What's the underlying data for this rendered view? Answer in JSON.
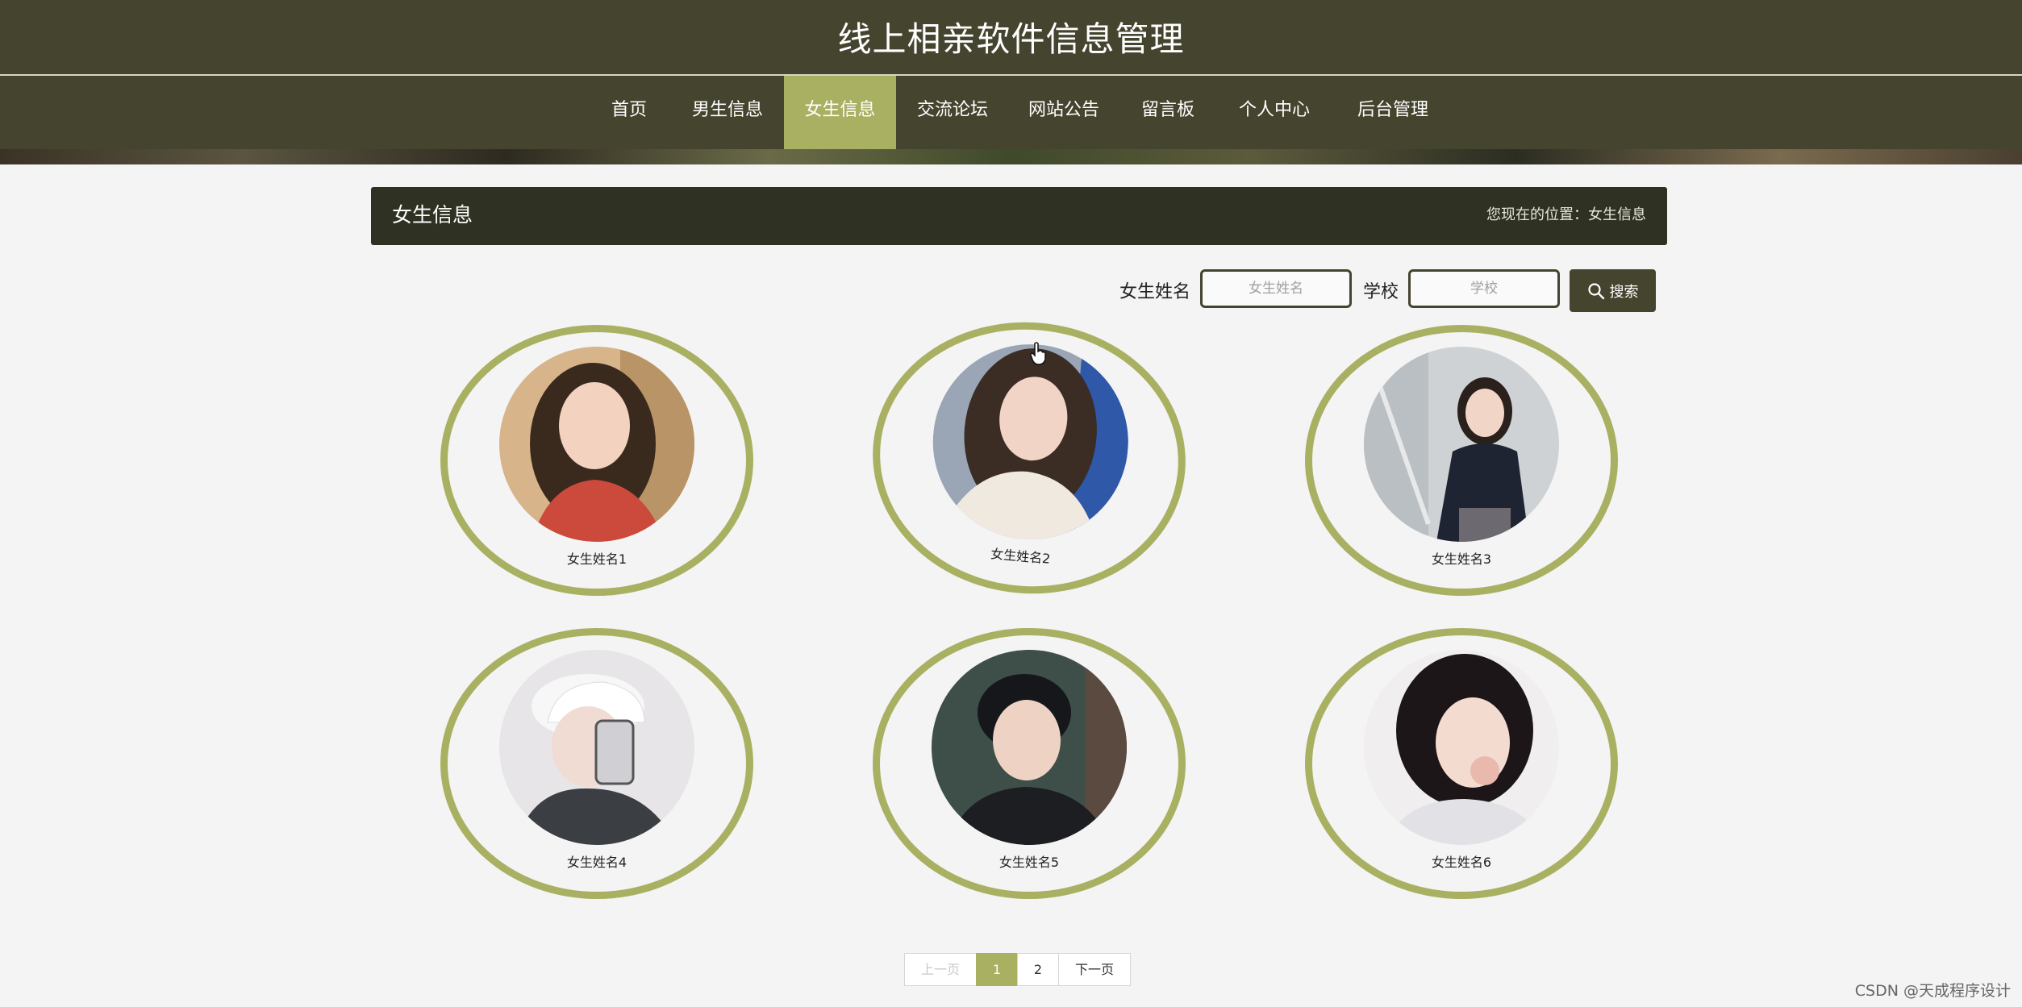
{
  "site": {
    "title": "线上相亲软件信息管理"
  },
  "nav": {
    "items": [
      {
        "label": "首页"
      },
      {
        "label": "男生信息"
      },
      {
        "label": "女生信息",
        "active": true
      },
      {
        "label": "交流论坛"
      },
      {
        "label": "网站公告"
      },
      {
        "label": "留言板"
      },
      {
        "label": "个人中心"
      },
      {
        "label": "后台管理"
      }
    ]
  },
  "page": {
    "heading": "女生信息",
    "location": "您现在的位置：女生信息"
  },
  "search": {
    "name_label": "女生姓名",
    "name_placeholder": "女生姓名",
    "school_label": "学校",
    "school_placeholder": "学校",
    "button_label": "搜索"
  },
  "cards": [
    {
      "name": "女生姓名1"
    },
    {
      "name": "女生姓名2"
    },
    {
      "name": "女生姓名3"
    },
    {
      "name": "女生姓名4"
    },
    {
      "name": "女生姓名5"
    },
    {
      "name": "女生姓名6"
    }
  ],
  "pagination": {
    "prev": "上一页",
    "pages": [
      "1",
      "2"
    ],
    "current": "1",
    "next": "下一页"
  },
  "watermark": "CSDN @天成程序设计",
  "colors": {
    "dark": "#45442f",
    "accent": "#a9b062",
    "background": "#f4f4f4"
  }
}
